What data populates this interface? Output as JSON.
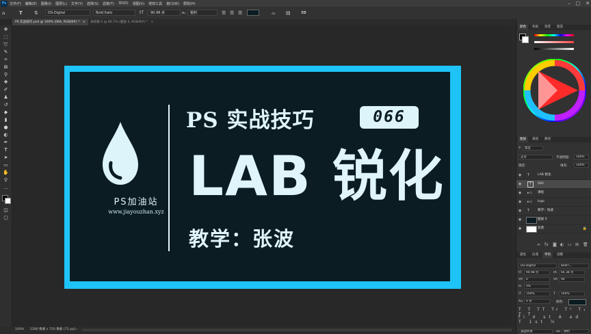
{
  "menubar": {
    "app_icon": "Ps",
    "items": [
      "文件(F)",
      "编辑(E)",
      "图像(I)",
      "图层(L)",
      "文字(Y)",
      "选择(S)",
      "滤镜(T)",
      "3D(D)",
      "视图(V)",
      "增效工具",
      "窗口(W)",
      "帮助(H)"
    ]
  },
  "options": {
    "tool_icon": "T",
    "font_family": "DS-Digital",
    "font_style": "Bold Italic",
    "font_size": "90.98 点",
    "antialias": "锐利",
    "three_d": "3D"
  },
  "tabs": [
    {
      "label": "PS 实战技巧.psd @ 100% (066, RGB/8#) *",
      "close": "×"
    },
    {
      "label": "未标题-1 @ 66.7% (图层 4, RGB/8#) *",
      "close": "×"
    }
  ],
  "canvas": {
    "logo_text": "PS加油站",
    "logo_url": "www.jiayouzhan.xyz",
    "title": "PS 实战技巧",
    "badge": "066",
    "headline": "LAB 锐化",
    "teacher": "教学：张波"
  },
  "status": {
    "zoom": "100%",
    "doc_size": "1280 像素 x 720 像素 (72 ppi)"
  },
  "panels": {
    "color_tabs": [
      "颜色",
      "色板",
      "渐变",
      "图案"
    ],
    "layers_tabs": [
      "图层",
      "通道",
      "路径"
    ],
    "kind_label": "类型",
    "blend_mode": "正常",
    "opacity_label": "不透明度:",
    "opacity_value": "100%",
    "lock_label": "锁定:",
    "fill_label": "填充:",
    "fill_value": "100%",
    "layers": [
      {
        "kind": "T",
        "name": "LAB 锐化",
        "selected": false
      },
      {
        "kind": "T",
        "name": "066",
        "selected": true
      },
      {
        "kind": "folder",
        "name": "课程",
        "selected": false
      },
      {
        "kind": "folder",
        "name": "logo",
        "selected": false
      },
      {
        "kind": "T",
        "name": "教学：张波",
        "selected": false
      },
      {
        "kind": "thumb-dark",
        "name": "图层 0",
        "selected": false
      },
      {
        "kind": "thumb-white",
        "name": "背景",
        "selected": false
      }
    ],
    "char_tabs": [
      "属性",
      "段落",
      "字符",
      "调整"
    ],
    "char_font": "DS-Digital",
    "char_style": "Bold I...",
    "char_size": "90.98 点",
    "char_leading": "64.38 点",
    "char_tracking_a": "0",
    "char_tracking_b": "90",
    "char_scale_label": "0%",
    "char_vscale": "100%",
    "char_hscale": "100%",
    "char_baseline": "0 点",
    "char_color_label": "颜色:",
    "char_lang": "美国英语",
    "char_aa": "锐利",
    "char_aa_label": "aa"
  },
  "colors": {
    "accent_border": "#1ec3f7",
    "canvas_bg": "#0b1c22",
    "text_light": "#dff5fb"
  }
}
